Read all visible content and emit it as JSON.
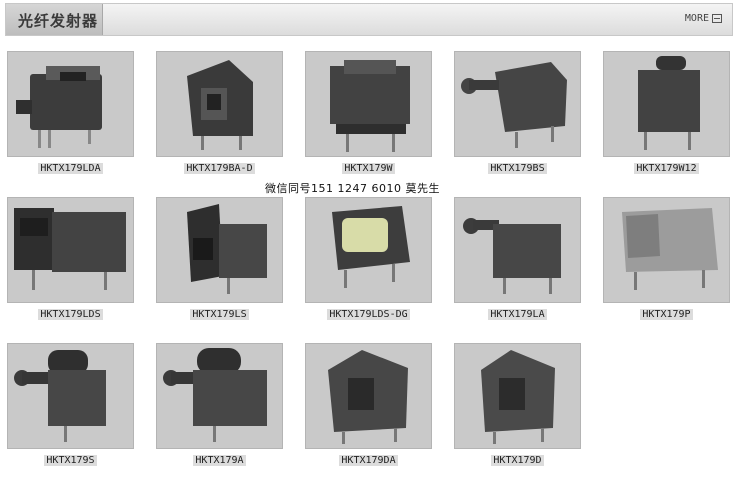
{
  "header": {
    "title": "光纤发射器",
    "more_label": "MORE"
  },
  "note": "微信同号151 1247 6010 莫先生",
  "products": [
    {
      "label": "HKTX179LDA"
    },
    {
      "label": "HKTX179BA-D"
    },
    {
      "label": "HKTX179W"
    },
    {
      "label": "HKTX179BS"
    },
    {
      "label": "HKTX179W12"
    },
    {
      "label": "HKTX179LDS"
    },
    {
      "label": "HKTX179LS"
    },
    {
      "label": "HKTX179LDS-DG"
    },
    {
      "label": "HKTX179LA"
    },
    {
      "label": "HKTX179P"
    },
    {
      "label": "HKTX179S"
    },
    {
      "label": "HKTX179A"
    },
    {
      "label": "HKTX179DA"
    },
    {
      "label": "HKTX179D"
    }
  ]
}
